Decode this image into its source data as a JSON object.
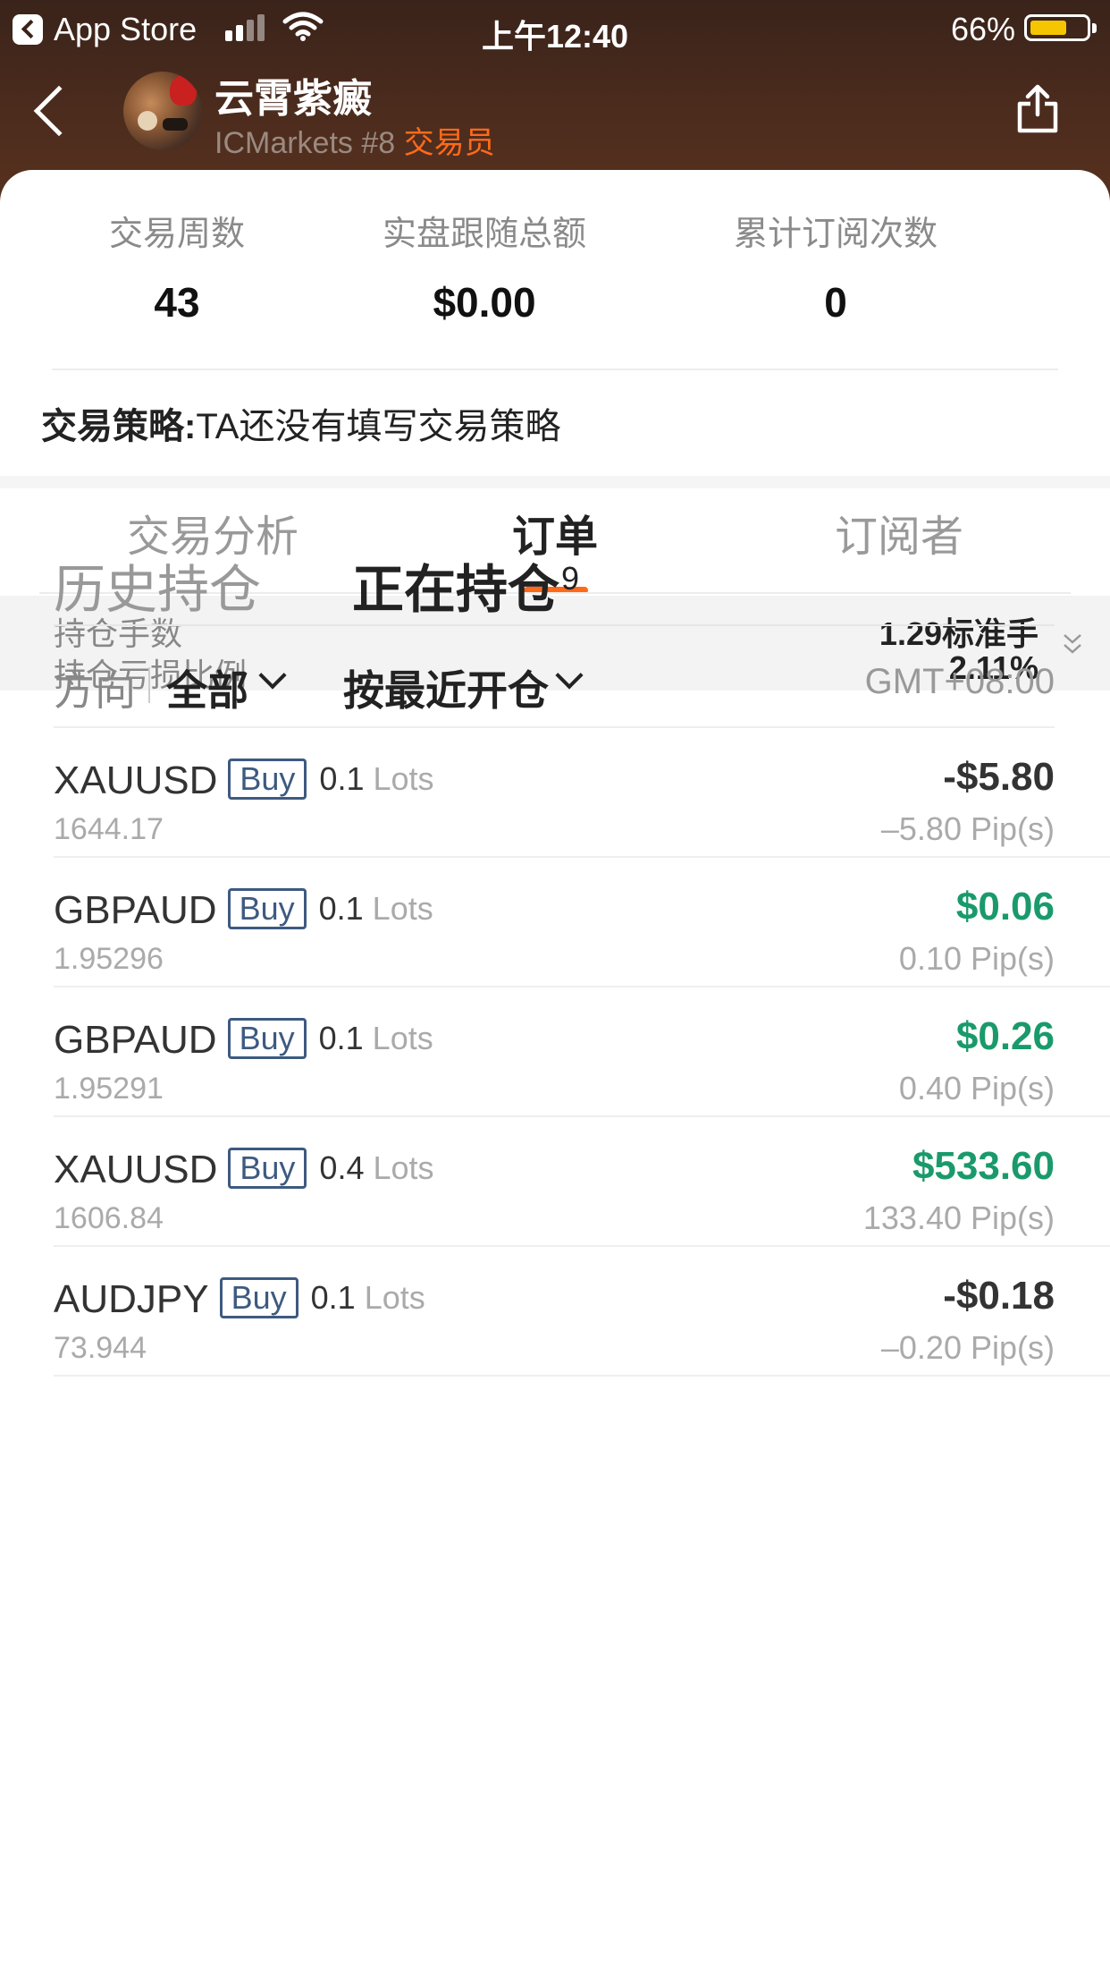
{
  "status_bar": {
    "back_app": "App Store",
    "time": "上午12:40",
    "battery": "66%"
  },
  "header": {
    "name": "云霄紫癜",
    "broker": "ICMarkets #8",
    "role": "交易员"
  },
  "stats": [
    {
      "label": "交易周数",
      "value": "43"
    },
    {
      "label": "实盘跟随总额",
      "value": "$0.00"
    },
    {
      "label": "累计订阅次数",
      "value": "0"
    }
  ],
  "strategy": {
    "label": "交易策略:",
    "text": "TA还没有填写交易策略"
  },
  "tabs": [
    {
      "label": "交易分析",
      "active": false
    },
    {
      "label": "订单",
      "active": true
    },
    {
      "label": "订阅者",
      "active": false
    }
  ],
  "summary": {
    "lots_label": "持仓手数",
    "lots_value": "1.29标准手",
    "loss_label": "持仓亏损比例",
    "loss_value": "2.11%"
  },
  "subtabs": {
    "history": "历史持仓",
    "open": "正在持仓",
    "open_count": "9"
  },
  "filters": {
    "direction_label": "方向",
    "direction_value": "全部",
    "sort_label": "按最近开仓",
    "timezone": "GMT+08:00"
  },
  "colors": {
    "accent": "#ff6a1a",
    "profit": "#1a9a6c",
    "buy_badge": "#3d5a80"
  },
  "positions": [
    {
      "symbol": "XAUUSD",
      "side": "Buy",
      "lots": "0.1",
      "lots_unit": "Lots",
      "open_price": "1644.17",
      "pnl": "-$5.80",
      "pips": "–5.80 Pip(s)",
      "positive": false
    },
    {
      "symbol": "GBPAUD",
      "side": "Buy",
      "lots": "0.1",
      "lots_unit": "Lots",
      "open_price": "1.95296",
      "pnl": "$0.06",
      "pips": "0.10 Pip(s)",
      "positive": true
    },
    {
      "symbol": "GBPAUD",
      "side": "Buy",
      "lots": "0.1",
      "lots_unit": "Lots",
      "open_price": "1.95291",
      "pnl": "$0.26",
      "pips": "0.40 Pip(s)",
      "positive": true
    },
    {
      "symbol": "XAUUSD",
      "side": "Buy",
      "lots": "0.4",
      "lots_unit": "Lots",
      "open_price": "1606.84",
      "pnl": "$533.60",
      "pips": "133.40 Pip(s)",
      "positive": true
    },
    {
      "symbol": "AUDJPY",
      "side": "Buy",
      "lots": "0.1",
      "lots_unit": "Lots",
      "open_price": "73.944",
      "pnl": "-$0.18",
      "pips": "–0.20 Pip(s)",
      "positive": false
    }
  ]
}
